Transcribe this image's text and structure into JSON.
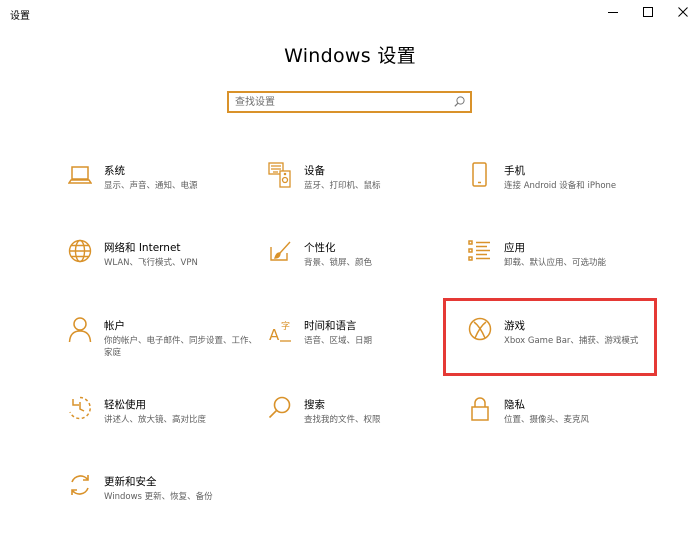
{
  "window": {
    "title": "设置"
  },
  "header": {
    "title": "Windows 设置"
  },
  "search": {
    "placeholder": "查找设置"
  },
  "accent_color": "#d9922a",
  "highlight_color": "#e53935",
  "categories": [
    {
      "title": "系统",
      "desc": "显示、声音、通知、电源",
      "icon": "laptop-icon"
    },
    {
      "title": "设备",
      "desc": "蓝牙、打印机、鼠标",
      "icon": "devices-icon"
    },
    {
      "title": "手机",
      "desc": "连接 Android 设备和 iPhone",
      "icon": "phone-icon"
    },
    {
      "title": "网络和 Internet",
      "desc": "WLAN、飞行模式、VPN",
      "icon": "globe-icon"
    },
    {
      "title": "个性化",
      "desc": "背景、锁屏、颜色",
      "icon": "brush-icon"
    },
    {
      "title": "应用",
      "desc": "卸载、默认应用、可选功能",
      "icon": "apps-list-icon"
    },
    {
      "title": "帐户",
      "desc": "你的帐户、电子邮件、同步设置、工作、家庭",
      "icon": "person-icon"
    },
    {
      "title": "时间和语言",
      "desc": "语音、区域、日期",
      "icon": "time-language-icon"
    },
    {
      "title": "游戏",
      "desc": "Xbox Game Bar、捕获、游戏模式",
      "icon": "xbox-icon",
      "highlighted": true
    },
    {
      "title": "轻松使用",
      "desc": "讲述人、放大镜、高对比度",
      "icon": "ease-of-access-icon"
    },
    {
      "title": "搜索",
      "desc": "查找我的文件、权限",
      "icon": "search-icon"
    },
    {
      "title": "隐私",
      "desc": "位置、摄像头、麦克风",
      "icon": "lock-icon"
    },
    {
      "title": "更新和安全",
      "desc": "Windows 更新、恢复、备份",
      "icon": "refresh-icon"
    }
  ]
}
